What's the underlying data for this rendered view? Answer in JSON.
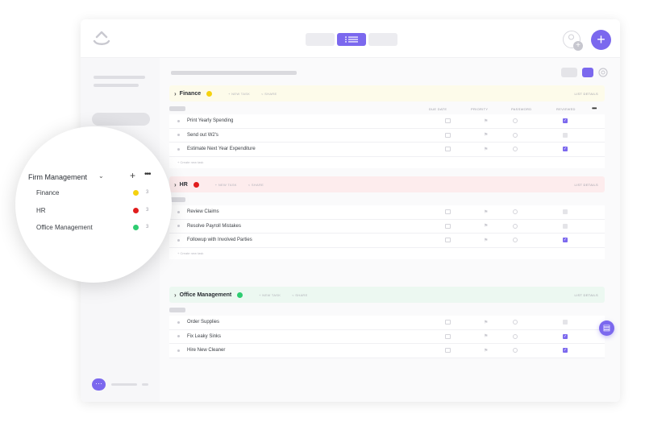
{
  "colors": {
    "accent": "#7b68ee",
    "finance": "#f5d20f",
    "hr": "#e11d1d",
    "office": "#2ecc71"
  },
  "sidebar_popup": {
    "title": "Firm Management",
    "add_icon": "plus-icon",
    "more_icon": "more-icon",
    "items": [
      {
        "label": "Finance",
        "count": "3",
        "color": "#f5d20f"
      },
      {
        "label": "HR",
        "count": "3",
        "color": "#e11d1d"
      },
      {
        "label": "Office Management",
        "count": "3",
        "color": "#2ecc71"
      }
    ]
  },
  "lists": [
    {
      "name": "Finance",
      "color": "#f5d20f",
      "new_task": "+ NEW TASK",
      "share": "SHARE",
      "details": "LIST DETAILS",
      "columns": [
        "DUE DATE",
        "PRIORITY",
        "PASSWORD",
        "REVIEWED"
      ],
      "tasks": [
        {
          "name": "Print Yearly Spending",
          "reviewed": true
        },
        {
          "name": "Send out W2's",
          "reviewed": false
        },
        {
          "name": "Estimate Next Year Expenditure",
          "reviewed": true
        }
      ],
      "create": "+ Create new task"
    },
    {
      "name": "HR",
      "color": "#e11d1d",
      "new_task": "+ NEW TASK",
      "share": "SHARE",
      "details": "LIST DETAILS",
      "tasks": [
        {
          "name": "Review Claims",
          "reviewed": false
        },
        {
          "name": "Resolve Payroll Mistakes",
          "reviewed": false
        },
        {
          "name": "Followup with Involved Parties",
          "reviewed": true
        }
      ],
      "create": "+ Create new task"
    },
    {
      "name": "Office Management",
      "color": "#2ecc71",
      "new_task": "+ NEW TASK",
      "share": "SHARE",
      "details": "LIST DETAILS",
      "tasks": [
        {
          "name": "Order Supplies",
          "reviewed": false
        },
        {
          "name": "Fix Leaky Sinks",
          "reviewed": true
        },
        {
          "name": "Hire New Cleaner",
          "reviewed": true
        }
      ]
    }
  ]
}
